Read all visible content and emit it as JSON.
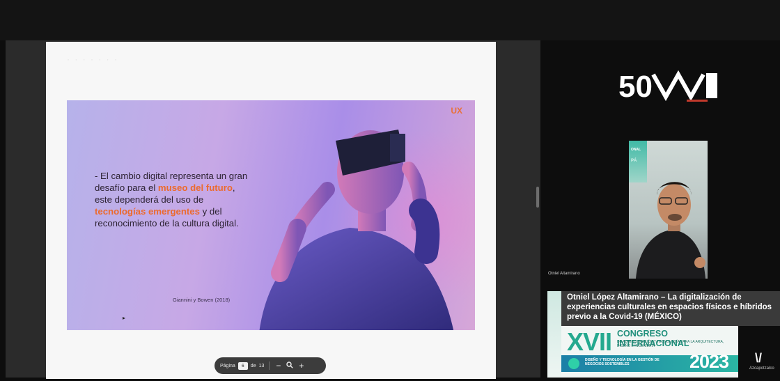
{
  "slide": {
    "header_faint": "· · · · · · ·",
    "logo_mark": "UX",
    "body": {
      "line1": "- El cambio digital representa un gran desafío para el ",
      "highlight1": "museo del futuro",
      "line2": ", este dependerá del uso de ",
      "highlight2": "tecnologías emergentes",
      "line3": " y del reconocimiento de la cultura digital."
    },
    "citation": "Giannini y Bowen (2018)"
  },
  "pdf_toolbar": {
    "page_label": "Página",
    "page_current": "6",
    "page_of": "de",
    "page_total": "13",
    "zoom_out": "−",
    "zoom_icon": "search-icon",
    "zoom_in": "+"
  },
  "event_logo": {
    "text": "50"
  },
  "video": {
    "banner_text1": "ONAL",
    "banner_text2": "PÁ",
    "participant_name": "Otniel Altamirano"
  },
  "lower_third": {
    "title": "Otniel López Altamirano – La digitalización de experiencias culturales en espacios físicos e híbridos previo a la Covid-19 (MÉXICO)"
  },
  "congreso": {
    "roman": "XVII",
    "title": "CONGRESO INTERNACIONAL",
    "subtitle": "DE ADMINISTRACIÓN Y TECNOLOGÍA PARA LA ARQUITECTURA, DISEÑO E INGENIERÍA",
    "strip_text": "DISEÑO Y TECNOLOGÍA EN LA GESTIÓN DE NEGOCIOS SOSTENIBLES",
    "year": "2023"
  },
  "azc_logo": {
    "mark": "\\/",
    "text": "Azcapotzalco"
  },
  "colors": {
    "highlight": "#ec6a2d",
    "congreso_green": "#25a98f"
  }
}
